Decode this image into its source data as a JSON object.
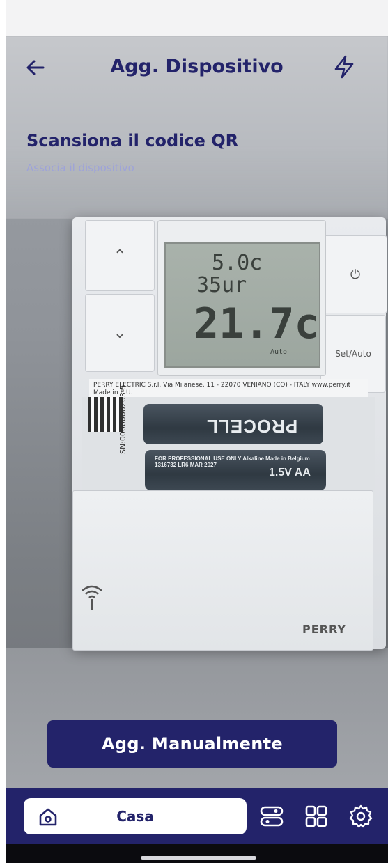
{
  "header": {
    "title": "Agg. Dispositivo",
    "back_icon": "arrow-left-icon",
    "flash_icon": "lightning-icon"
  },
  "scan": {
    "title": "Scansiona il codice QR",
    "subtitle": "Associa il dispositivo"
  },
  "camera_preview": {
    "lcd_line1": "5.0c",
    "lcd_line2": "35ur",
    "lcd_temp": "21.7c",
    "lcd_mode": "Auto",
    "label_text": "PERRY ELECTRIC S.r.l. Via Milanese, 11 - 22070 VENIANO (CO) - ITALY www.perry.it",
    "label_made": "Made in E.U.",
    "serial": "SN:0000000203-5",
    "battery_brand": "PROCELL",
    "battery_fine": "FOR PROFESSIONAL USE ONLY Alkaline Made in Belgium 1316732 LR6 MAR 2027",
    "battery_size": "1.5V AA",
    "set_auto_label": "Set/Auto",
    "device_brand": "PERRY"
  },
  "cta": {
    "label": "Agg. Manualmente"
  },
  "bottom_nav": {
    "home_label": "Casa",
    "items": [
      "home-icon",
      "scenes-icon",
      "grid-icon",
      "settings-icon"
    ]
  },
  "colors": {
    "primary": "#23236a",
    "subtitle": "#9ea3d8"
  }
}
